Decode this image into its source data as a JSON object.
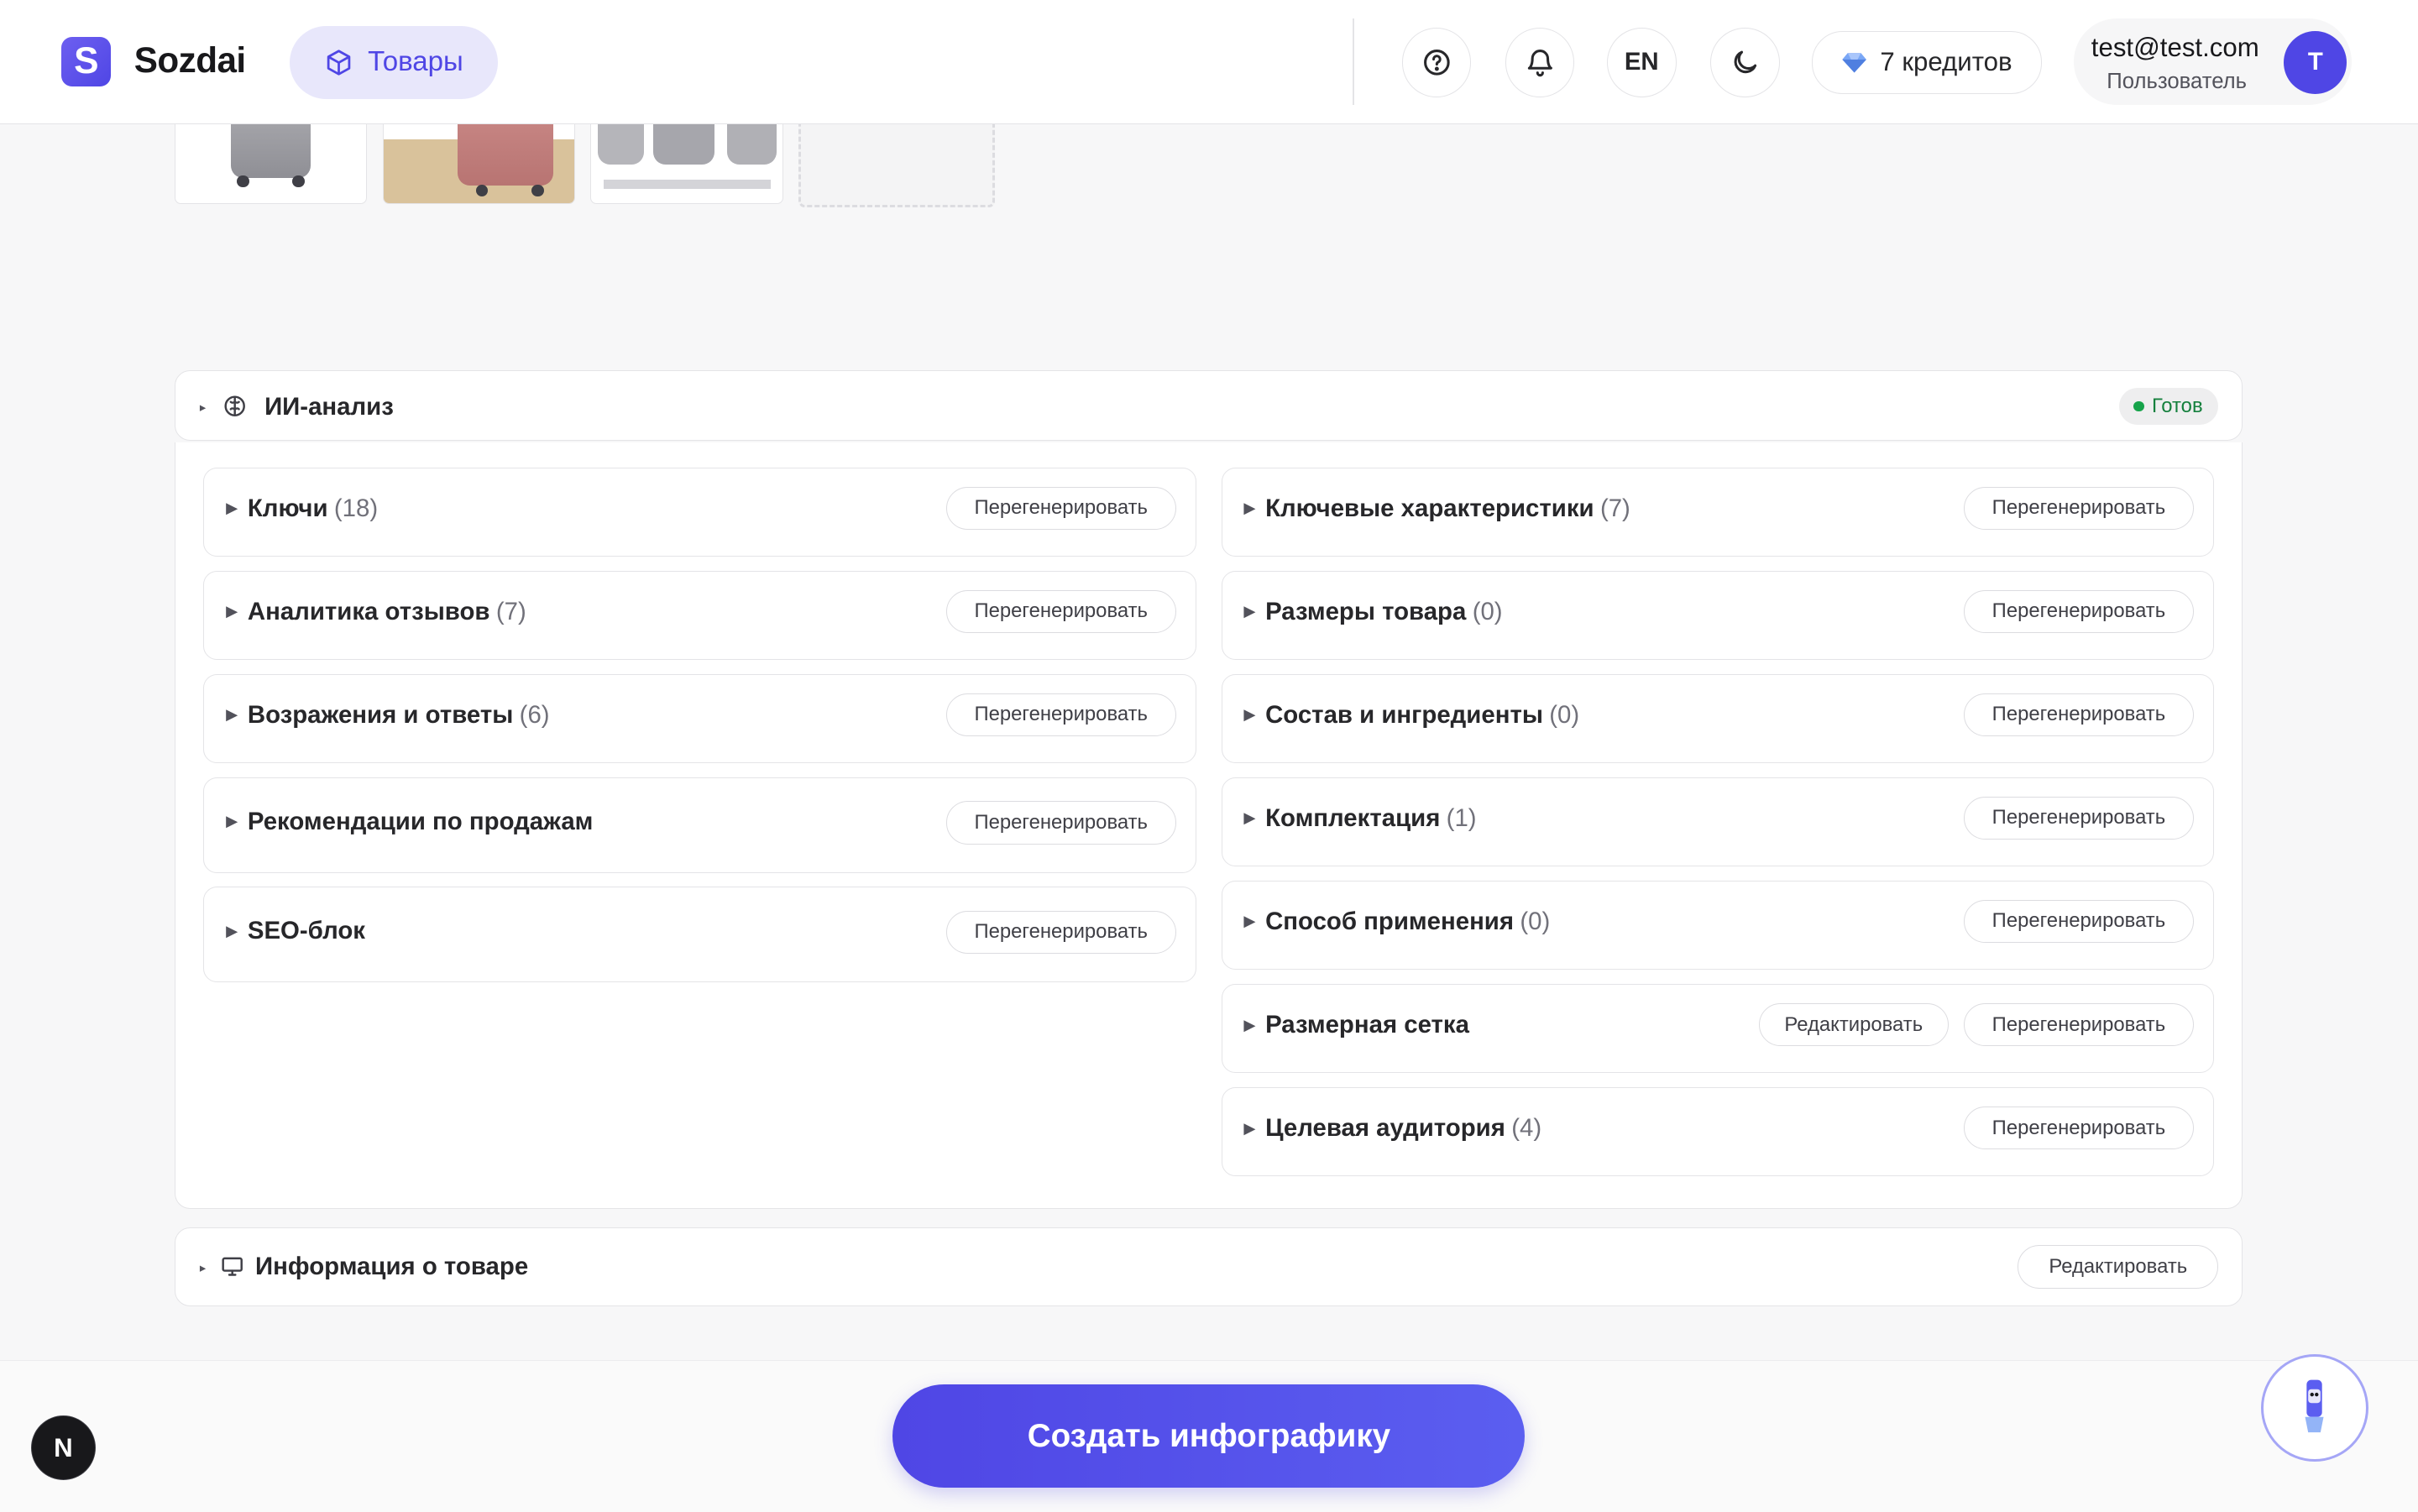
{
  "header": {
    "logo_letter": "S",
    "brand": "Sozdai",
    "nav_active": "Товары",
    "lang": "EN",
    "credits": "7 кредитов",
    "user_email": "test@test.com",
    "user_role": "Пользователь",
    "avatar_letter": "T"
  },
  "ai_panel": {
    "title": "ИИ-анализ",
    "status": "Готов",
    "left_cards": [
      {
        "title": "Ключи",
        "count": "(18)",
        "regen": "Перегенерировать"
      },
      {
        "title": "Аналитика отзывов",
        "count": "(7)",
        "regen": "Перегенерировать"
      },
      {
        "title": "Возражения и ответы",
        "count": "(6)",
        "regen": "Перегенерировать"
      },
      {
        "title": "Рекомендации по продажам",
        "count": "",
        "regen": "Перегенерировать"
      },
      {
        "title": "SEO-блок",
        "count": "",
        "regen": "Перегенерировать"
      }
    ],
    "right_cards": [
      {
        "title": "Ключевые характеристики",
        "count": "(7)",
        "regen": "Перегенерировать"
      },
      {
        "title": "Размеры товара",
        "count": "(0)",
        "regen": "Перегенерировать"
      },
      {
        "title": "Состав и ингредиенты",
        "count": "(0)",
        "regen": "Перегенерировать"
      },
      {
        "title": "Комплектация",
        "count": "(1)",
        "regen": "Перегенерировать"
      },
      {
        "title": "Способ применения",
        "count": "(0)",
        "regen": "Перегенерировать"
      },
      {
        "title": "Размерная сетка",
        "count": "",
        "edit": "Редактировать",
        "regen": "Перегенерировать"
      },
      {
        "title": "Целевая аудитория",
        "count": "(4)",
        "regen": "Перегенерировать"
      }
    ]
  },
  "info_panel": {
    "title": "Информация о товаре",
    "edit": "Редактировать"
  },
  "cta_label": "Создать инфографику",
  "dev_badge": "N"
}
